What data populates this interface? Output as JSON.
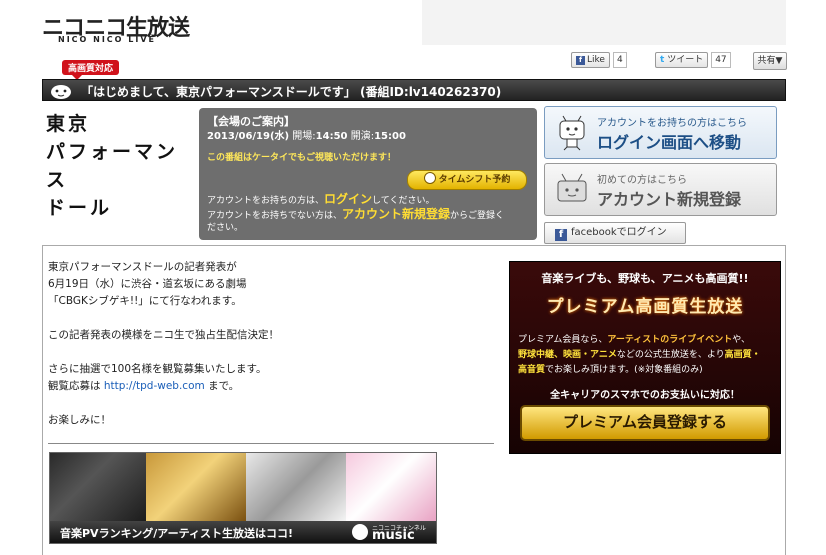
{
  "header": {
    "logo_main": "ニコニコ生放送",
    "logo_sub": "NICO NICO LIVE"
  },
  "social": {
    "like_label": "Like",
    "like_count": "4",
    "tweet_label": "ツイート",
    "tweet_count": "47",
    "share_label": "共有▼"
  },
  "hq_badge": "高画質対応",
  "title_bar": "「はじめまして、東京パフォーマンスドールです」 (番組ID:lv140262370)",
  "program_name_lines": [
    "東京",
    "パフォーマンス",
    "ドール"
  ],
  "venue": {
    "heading": "【会場のご案内】",
    "date": "2013/06/19(水)",
    "open_label": "開場:",
    "open_time": "14:50",
    "start_label": "開演:",
    "start_time": "15:00",
    "mobile_note": "この番組はケータイでもご視聴いただけます！",
    "timeshift_label": "タイムシフト予約",
    "line1_pre": "アカウントをお持ちの方は、",
    "line1_link": "ログイン",
    "line1_post": "してください。",
    "line2_pre": "アカウントをお持ちでない方は、",
    "line2_link": "アカウント新規登録",
    "line2_post": "からご登録く",
    "line3": "ださい。"
  },
  "login": {
    "small": "アカウントをお持ちの方はこちら",
    "big": "ログイン画面へ移動"
  },
  "signup": {
    "small": "初めての方はこちら",
    "big": "アカウント新規登録"
  },
  "facebook_login": "facebookでログイン",
  "description": {
    "p1_l1": "東京パフォーマンスドールの記者発表が",
    "p1_l2": "6月19日（水）に渋谷・道玄坂にある劇場",
    "p1_l3": "「CBGKシブゲキ!!」にて行なわれます。",
    "p2": "この記者発表の模様をニコ生で独占生配信決定！",
    "p3_l1": "さらに抽選で100名様を観覧募集いたします。",
    "p3_l2_pre": "観覧応募は ",
    "p3_l2_link": "http://tpd-web.com",
    "p3_l2_post": " まで。",
    "p4": "お楽しみに！"
  },
  "premium": {
    "top": "音楽ライブも、野球も、アニメも高画質!!",
    "title": "プレミアム高画質生放送",
    "b1_pre": "プレミアム会員なら、",
    "b1_hl": "アーティストのライブイベント",
    "b1_post": "や、",
    "b2_hl1": "野球中継、映画・アニメ",
    "b2_mid": "などの公式生放送を、より",
    "b2_hl2": "高画質・",
    "b3_hl": "高音質",
    "b3_post": "でお楽しみ頂けます。(※対象番組のみ)",
    "carrier": "全キャリアのスマホでのお支払いに対応！",
    "button": "プレミアム会員登録する"
  },
  "music_banner": {
    "caption": "音楽PVランキング/アーティスト生放送はココ!",
    "channel_small": "ニコニコチャンネル",
    "channel_name": "music"
  }
}
